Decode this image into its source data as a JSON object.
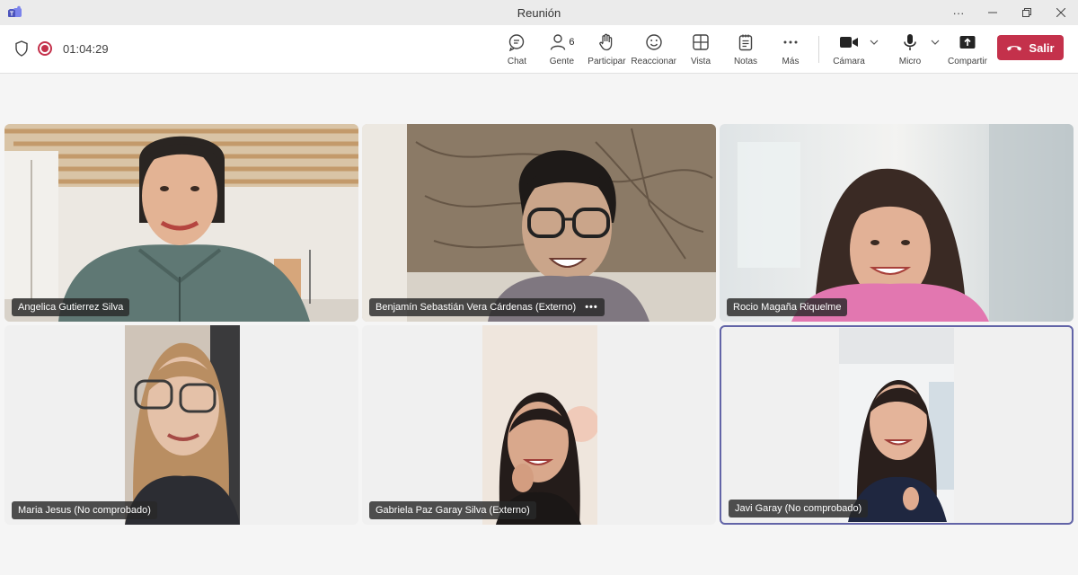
{
  "window": {
    "title": "Reunión"
  },
  "call": {
    "elapsed": "01:04:29"
  },
  "toolbar": {
    "chat": "Chat",
    "people": "Gente",
    "people_count": "6",
    "raise_hand": "Participar",
    "react": "Reaccionar",
    "view": "Vista",
    "notes": "Notas",
    "more": "Más",
    "camera": "Cámara",
    "mic": "Micro",
    "share": "Compartir",
    "leave": "Salir"
  },
  "participants": [
    {
      "name": "Angelica Gutierrez Silva"
    },
    {
      "name": "Benjamín Sebastián Vera Cárdenas (Externo)",
      "more": "•••"
    },
    {
      "name": "Rocio Magaña Riquelme"
    },
    {
      "name": "Maria Jesus (No comprobado)"
    },
    {
      "name": "Gabriela Paz Garay Silva (Externo)"
    },
    {
      "name": "Javi Garay (No comprobado)",
      "active": true
    }
  ],
  "colors": {
    "accent": "#6264a7",
    "leave": "#c4314b",
    "recording": "#c4314b"
  }
}
